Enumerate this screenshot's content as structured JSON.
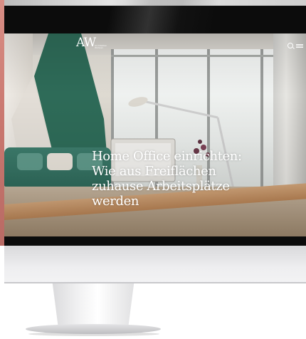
{
  "header": {
    "logo": "AW",
    "logo_sub": "Architekten Wohnen",
    "icons": [
      "search-icon",
      "menu-icon"
    ]
  },
  "hero": {
    "title": "Home Office einrichten: Wie aus Freiflächen zuhause Arbeitsplätze werden"
  },
  "colors": {
    "bezel": "#0c0c0c",
    "accent_green": "#2f6a5b",
    "text_white": "#ffffff"
  }
}
